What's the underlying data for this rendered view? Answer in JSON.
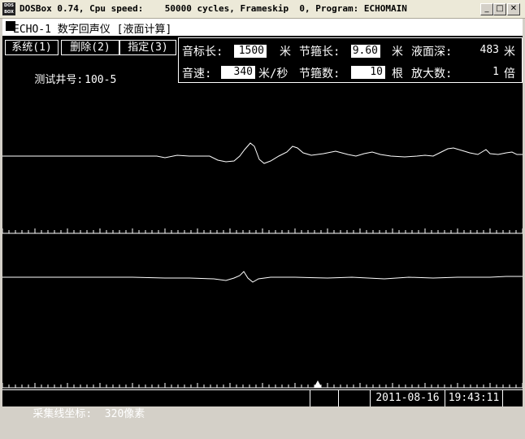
{
  "window": {
    "title": "DOSBox 0.74, Cpu speed:    50000 cycles, Frameskip  0, Program: ECHOMAIN",
    "icon_text": "DOS BOX",
    "buttons": [
      "minimize-icon",
      "maximize-icon",
      "close-icon"
    ]
  },
  "app": {
    "title": "ECHO-1 数字回声仪 [液面计算]"
  },
  "menu": {
    "items": [
      "系统(1)",
      "删除(2)",
      "指定(3)"
    ]
  },
  "well": {
    "label": "测试井号:",
    "value": "100-5"
  },
  "params": {
    "marker_length_label": "音标长:",
    "marker_length_value": "1500",
    "marker_length_unit": "米",
    "joint_length_label": "节箍长:",
    "joint_length_value": "9.60",
    "joint_length_unit": "米",
    "liquid_depth_label": "液面深:",
    "liquid_depth_value": "483",
    "liquid_depth_unit": "米",
    "sound_speed_label": "音速:",
    "sound_speed_value": "340",
    "sound_speed_unit": "米/秒",
    "joint_count_label": "节箍数:",
    "joint_count_value": "10",
    "joint_count_unit": "根",
    "magnification_label": "放大数:",
    "magnification_value": "1",
    "magnification_unit": "倍"
  },
  "status": {
    "cursor_label": "采集线坐标:",
    "cursor_value": "320像素",
    "date": "2011-08-16",
    "time": "19:43:11"
  },
  "colors": {
    "screen_bg": "#000000",
    "trace": "#ffffff",
    "field_bg": "#ffffff"
  }
}
